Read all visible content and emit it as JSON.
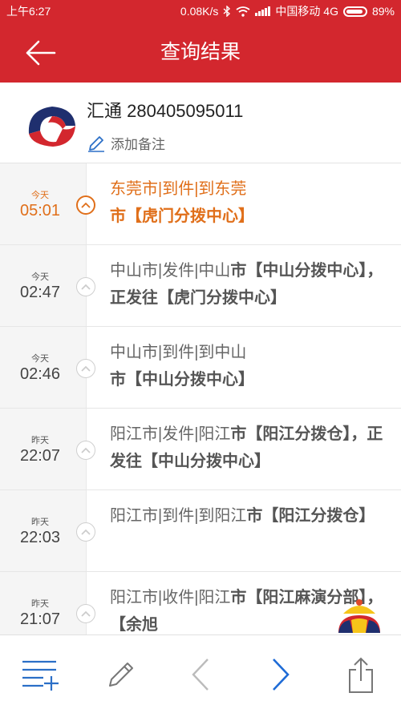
{
  "status_bar": {
    "time": "上午6:27",
    "net_speed": "0.08K/s",
    "carrier": "中国移动 4G",
    "battery": "89%"
  },
  "app_bar": {
    "title": "查询结果",
    "back_icon": "arrow-left-icon"
  },
  "shipment": {
    "courier_and_number": "汇通 280405095011",
    "add_note": "添加备注"
  },
  "timeline": [
    {
      "day": "今天",
      "time": "05:01",
      "current": true,
      "text": "东莞市|到件|到东莞",
      "bold": "市【虎门分拨中心】"
    },
    {
      "day": "今天",
      "time": "02:47",
      "current": false,
      "text": "中山市|发件|中山",
      "bold": "市【中山分拨中心】，正发往【虎门分拨中心】"
    },
    {
      "day": "今天",
      "time": "02:46",
      "current": false,
      "text": "中山市|到件|到中山",
      "bold": "市【中山分拨中心】"
    },
    {
      "day": "昨天",
      "time": "22:07",
      "current": false,
      "text": "阳江市|发件|阳江",
      "bold": "市【阳江分拨仓】，正发往【中山分拨中心】"
    },
    {
      "day": "昨天",
      "time": "22:03",
      "current": false,
      "text": "阳江市|到件|到阳江",
      "bold": "市【阳江分拨仓】"
    },
    {
      "day": "昨天",
      "time": "21:07",
      "current": false,
      "text": "阳江市|收件|阳江",
      "bold": "市【阳江麻演分部】，【余旭"
    }
  ],
  "toolbar": {
    "icons": [
      "list-add-icon",
      "pencil-icon",
      "chevron-left-icon",
      "chevron-right-icon",
      "share-icon"
    ]
  },
  "colors": {
    "brand_red": "#d3272e",
    "current_orange": "#e06f1a",
    "nav_blue": "#1e6bd6"
  }
}
